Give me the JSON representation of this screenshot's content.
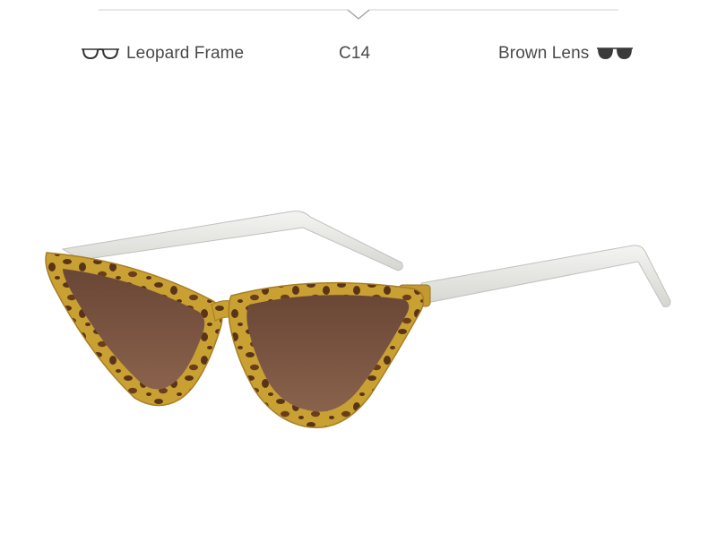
{
  "specs": {
    "frame_label": "Leopard Frame",
    "frame_icon": "glasses-outline-icon",
    "code": "C14",
    "lens_label": "Brown Lens",
    "lens_icon": "dark-lenses-icon"
  },
  "product": {
    "image": "leopard-cat-eye-sunglasses",
    "colors": {
      "frame": "#c9a032",
      "spots": "#5a3418",
      "lens": "#7a5340",
      "temple": "#e6e6e3"
    }
  }
}
